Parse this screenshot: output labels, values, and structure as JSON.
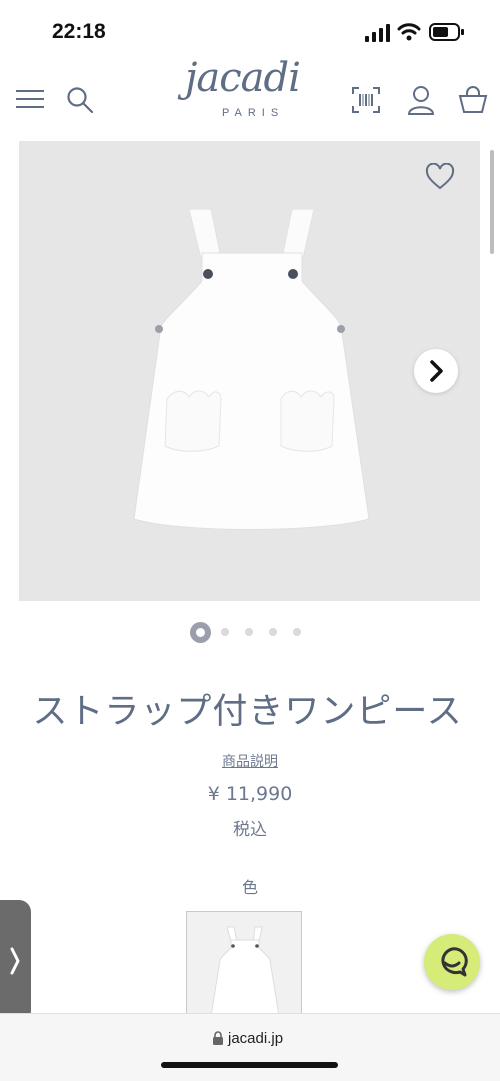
{
  "status_bar": {
    "time": "22:18"
  },
  "header": {
    "logo": "jacadi",
    "logo_sub": "PARIS"
  },
  "product": {
    "title": "ストラップ付きワンピース",
    "description_link": "商品説明",
    "price": "¥ 11,990",
    "tax_note": "税込",
    "color_label": "色"
  },
  "gallery": {
    "image_count": 5,
    "active_index": 1
  },
  "browser": {
    "url": "jacadi.jp"
  },
  "colors": {
    "accent": "#5f6d85",
    "chat": "#d6ec78",
    "panel": "#e6e6e6"
  }
}
